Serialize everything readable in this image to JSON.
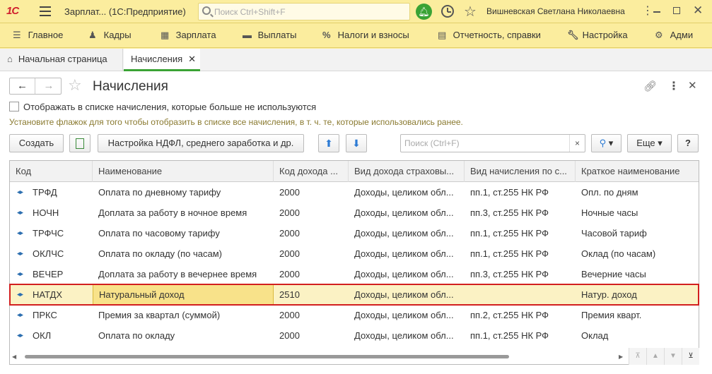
{
  "titlebar": {
    "logo": "1С",
    "app_title": "Зарплат... (1С:Предприятие)",
    "search_placeholder": "Поиск Ctrl+Shift+F",
    "user": "Вишневская Светлана Николаевна"
  },
  "sections": [
    {
      "label": "Главное",
      "icon": "list-icon"
    },
    {
      "label": "Кадры",
      "icon": "people-icon"
    },
    {
      "label": "Зарплата",
      "icon": "calculator-icon"
    },
    {
      "label": "Выплаты",
      "icon": "wallet-icon"
    },
    {
      "label": "Налоги и взносы",
      "icon": "percent-icon"
    },
    {
      "label": "Отчетность, справки",
      "icon": "reports-icon"
    },
    {
      "label": "Настройка",
      "icon": "wrench-icon"
    },
    {
      "label": "Адми",
      "icon": "gear-icon"
    }
  ],
  "tabs": {
    "home": "Начальная страница",
    "active": "Начисления"
  },
  "form": {
    "title": "Начисления",
    "checkbox_label": "Отображать в списке начисления, которые больше не используются",
    "hint": "Установите флажок для того чтобы отобразить в списке все начисления, в т. ч. те, которые использовались ранее.",
    "create_label": "Создать",
    "ndfl_label": "Настройка НДФЛ, среднего заработка и др.",
    "search_placeholder": "Поиск (Ctrl+F)",
    "more_label": "Еще",
    "help_label": "?"
  },
  "table": {
    "columns": [
      "Код",
      "Наименование",
      "Код дохода ...",
      "Вид дохода страховы...",
      "Вид начисления по с...",
      "Краткое наименование"
    ],
    "rows": [
      {
        "code": "ТРФД",
        "name": "Оплата по дневному тарифу",
        "income_code": "2000",
        "ins_type": "Доходы, целиком обл...",
        "accrual_type": "пп.1, ст.255 НК РФ",
        "short": "Опл. по дням"
      },
      {
        "code": "НОЧН",
        "name": "Доплата за работу в ночное время",
        "income_code": "2000",
        "ins_type": "Доходы, целиком обл...",
        "accrual_type": "пп.3, ст.255 НК РФ",
        "short": "Ночные часы"
      },
      {
        "code": "ТРФЧС",
        "name": "Оплата по часовому тарифу",
        "income_code": "2000",
        "ins_type": "Доходы, целиком обл...",
        "accrual_type": "пп.1, ст.255 НК РФ",
        "short": "Часовой тариф"
      },
      {
        "code": "ОКЛЧС",
        "name": "Оплата по окладу (по часам)",
        "income_code": "2000",
        "ins_type": "Доходы, целиком обл...",
        "accrual_type": "пп.1, ст.255 НК РФ",
        "short": "Оклад (по часам)"
      },
      {
        "code": "ВЕЧЕР",
        "name": "Доплата за работу в вечернее время",
        "income_code": "2000",
        "ins_type": "Доходы, целиком обл...",
        "accrual_type": "пп.3, ст.255 НК РФ",
        "short": "Вечерние часы"
      },
      {
        "code": "НАТДХ",
        "name": "Натуральный доход",
        "income_code": "2510",
        "ins_type": "Доходы, целиком обл...",
        "accrual_type": "",
        "short": "Натур. доход"
      },
      {
        "code": "ПРКС",
        "name": "Премия за квартал (суммой)",
        "income_code": "2000",
        "ins_type": "Доходы, целиком обл...",
        "accrual_type": "пп.2, ст.255 НК РФ",
        "short": "Премия кварт."
      },
      {
        "code": "ОКЛ",
        "name": "Оплата по окладу",
        "income_code": "2000",
        "ins_type": "Доходы, целиком обл...",
        "accrual_type": "пп.1, ст.255 НК РФ",
        "short": "Оклад"
      }
    ],
    "selected_row": 5
  },
  "colors": {
    "header_bg": "#fbed9e",
    "accent_green": "#3aa335",
    "selection_bg": "#fbf2c4",
    "highlight_border": "#d21f1f"
  }
}
